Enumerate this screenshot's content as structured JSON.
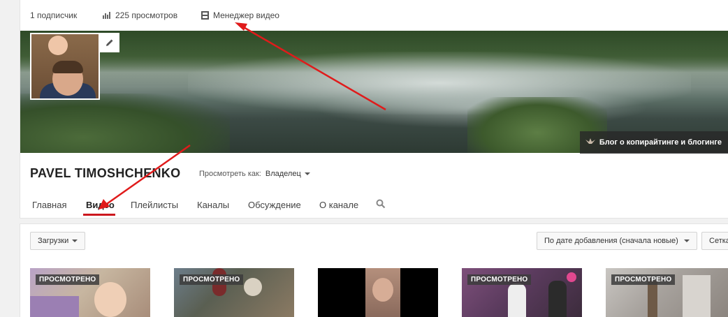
{
  "stats": {
    "subscribers": "1 подписчик",
    "views": "225 просмотров",
    "video_manager": "Менеджер видео"
  },
  "channel": {
    "name": "PAVEL TIMOSHCHENKO",
    "view_as_label": "Просмотреть как:",
    "view_as_value": "Владелец",
    "banner_link": "Блог о копирайтинге и блогинге"
  },
  "tabs": [
    {
      "label": "Главная"
    },
    {
      "label": "Видео",
      "active": true
    },
    {
      "label": "Плейлисты"
    },
    {
      "label": "Каналы"
    },
    {
      "label": "Обсуждение"
    },
    {
      "label": "О канале"
    }
  ],
  "toolbar": {
    "uploads_label": "Загрузки",
    "sort_label": "По дате добавления (сначала новые)",
    "grid_label": "Сетка"
  },
  "videos": [
    {
      "badge": "ПРОСМОТРЕНО"
    },
    {
      "badge": "ПРОСМОТРЕНО"
    },
    {
      "badge": ""
    },
    {
      "badge": "ПРОСМОТРЕНО"
    },
    {
      "badge": "ПРОСМОТРЕНО"
    }
  ],
  "colors": {
    "accent": "#cc181e",
    "annotation_arrow": "#e01b1b"
  },
  "icons": {
    "views": "bar-chart-icon",
    "video_manager": "film-icon",
    "edit": "pencil-icon",
    "search": "search-icon",
    "link": "site-favicon-icon"
  }
}
